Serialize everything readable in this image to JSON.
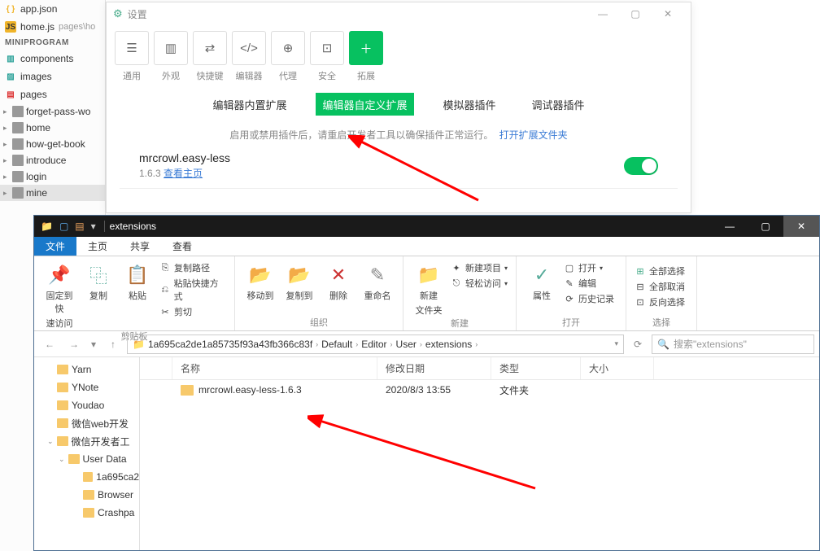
{
  "ide": {
    "open_files": [
      {
        "name": "app.json",
        "icon": "{}",
        "iconColor": "#f0b429"
      },
      {
        "name": "home.js",
        "icon": "JS",
        "iconColor": "#f0b429",
        "path": "pages\\ho"
      }
    ],
    "section": "MINIPROGRAM",
    "roots": [
      {
        "name": "components",
        "icon": "cmp",
        "color": "#2aa198"
      },
      {
        "name": "images",
        "icon": "img",
        "color": "#2aa198"
      },
      {
        "name": "pages",
        "icon": "pg",
        "color": "#d33"
      }
    ],
    "tree": [
      "forget-pass-wo",
      "home",
      "how-get-book",
      "introduce",
      "login",
      "mine"
    ]
  },
  "settings": {
    "title": "设置",
    "toolbar": [
      "通用",
      "外观",
      "快捷键",
      "编辑器",
      "代理",
      "安全",
      "拓展"
    ],
    "tabs": [
      "编辑器内置扩展",
      "编辑器自定义扩展",
      "模拟器插件",
      "调试器插件"
    ],
    "note": "启用或禁用插件后，请重启开发者工具以确保插件正常运行。",
    "note_link": "打开扩展文件夹",
    "ext": {
      "name": "mrcrowl.easy-less",
      "ver": "1.6.3",
      "link": "查看主页"
    }
  },
  "explorer": {
    "title": "extensions",
    "tabs": [
      "文件",
      "主页",
      "共享",
      "查看"
    ],
    "ribbon": {
      "pin": {
        "l1": "固定到快",
        "l2": "速访问"
      },
      "copy": "复制",
      "paste": "粘贴",
      "clip1": "复制路径",
      "clip2": "粘贴快捷方式",
      "cut": "剪切",
      "g1": "剪贴板",
      "move": "移动到",
      "copyto": "复制到",
      "delete": "删除",
      "rename": "重命名",
      "g2": "组织",
      "newfolder": {
        "l1": "新建",
        "l2": "文件夹"
      },
      "newitem": "新建项目",
      "easy": "轻松访问",
      "g3": "新建",
      "props": "属性",
      "open": "打开",
      "edit": "编辑",
      "history": "历史记录",
      "g4": "打开",
      "selall": "全部选择",
      "selnone": "全部取消",
      "selinv": "反向选择",
      "g5": "选择"
    },
    "breadcrumb": [
      "1a695ca2de1a85735f93a43fb366c83f",
      "Default",
      "Editor",
      "User",
      "extensions"
    ],
    "search_ph": "搜索\"extensions\"",
    "cols": {
      "name": "名称",
      "date": "修改日期",
      "type": "类型",
      "size": "大小"
    },
    "tree": [
      {
        "name": "Yarn",
        "indent": 28
      },
      {
        "name": "YNote",
        "indent": 28
      },
      {
        "name": "Youdao",
        "indent": 28
      },
      {
        "name": "微信web开发",
        "indent": 28
      },
      {
        "name": "微信开发者工",
        "indent": 28,
        "open": true
      },
      {
        "name": "User Data",
        "indent": 44,
        "open": true
      },
      {
        "name": "1a695ca2",
        "indent": 60
      },
      {
        "name": "Browser",
        "indent": 60
      },
      {
        "name": "Crashpa",
        "indent": 60
      }
    ],
    "row": {
      "name": "mrcrowl.easy-less-1.6.3",
      "date": "2020/8/3 13:55",
      "type": "文件夹",
      "size": ""
    }
  }
}
